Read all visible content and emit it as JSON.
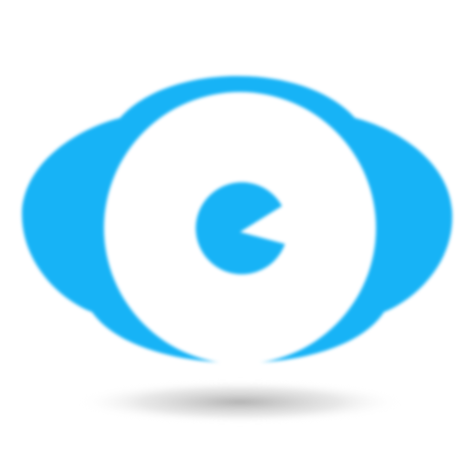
{
  "app": {
    "icon": "eye-shaped-app-logo-icon",
    "inner_icon": "pie-pupil-icon"
  },
  "colors": {
    "brand": "#17b3f6",
    "inner_fill": "#ffffff",
    "background": "#ffffff",
    "shadow": "#b8b8b8"
  }
}
